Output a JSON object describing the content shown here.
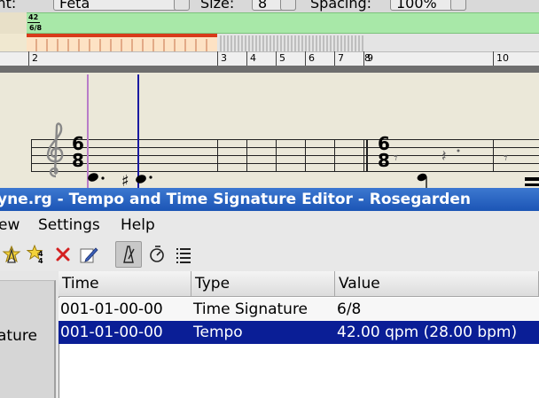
{
  "top_toolbar": {
    "font_label": "Font:",
    "font_value": "Feta",
    "size_label": "Size:",
    "size_value": "8",
    "spacing_label": "Spacing:",
    "spacing_value": "100%"
  },
  "tempo_ruler": {
    "tempo_marker": "42",
    "time_signature": "6/8"
  },
  "bar_ruler": {
    "numbers": [
      "2",
      "3",
      "4",
      "5",
      "6",
      "7",
      "8",
      "9",
      "10"
    ]
  },
  "staff": {
    "time_sig_1_top": "6",
    "time_sig_1_bottom": "8",
    "time_sig_2_top": "6",
    "time_sig_2_bottom": "8"
  },
  "window": {
    "title": "yne.rg - Tempo and Time Signature Editor - Rosegarden"
  },
  "menu": {
    "items": [
      "ew",
      "Settings",
      "Help"
    ]
  },
  "toolbar": {
    "buttons": [
      {
        "name": "add-tempo-change-icon"
      },
      {
        "name": "add-time-signature-icon"
      },
      {
        "name": "delete-icon"
      },
      {
        "name": "edit-icon"
      },
      {
        "name": "metronome-icon"
      },
      {
        "name": "time-signature-filter-icon"
      },
      {
        "name": "list-view-icon"
      }
    ]
  },
  "left_panel": {
    "label": "ature"
  },
  "table": {
    "columns": [
      "Time",
      "Type",
      "Value"
    ],
    "rows": [
      {
        "time": "001-01-00-00",
        "type": "Time Signature",
        "value": "6/8",
        "selected": false
      },
      {
        "time": "001-01-00-00",
        "type": "Tempo",
        "value": "42.00 qpm (28.00 bpm)",
        "selected": true
      }
    ]
  },
  "colors": {
    "selection": "#0a1e96",
    "title_bar": "#1c55b5",
    "tempo_ruler": "#a8e8a8",
    "segment_red": "#d83a1a"
  }
}
